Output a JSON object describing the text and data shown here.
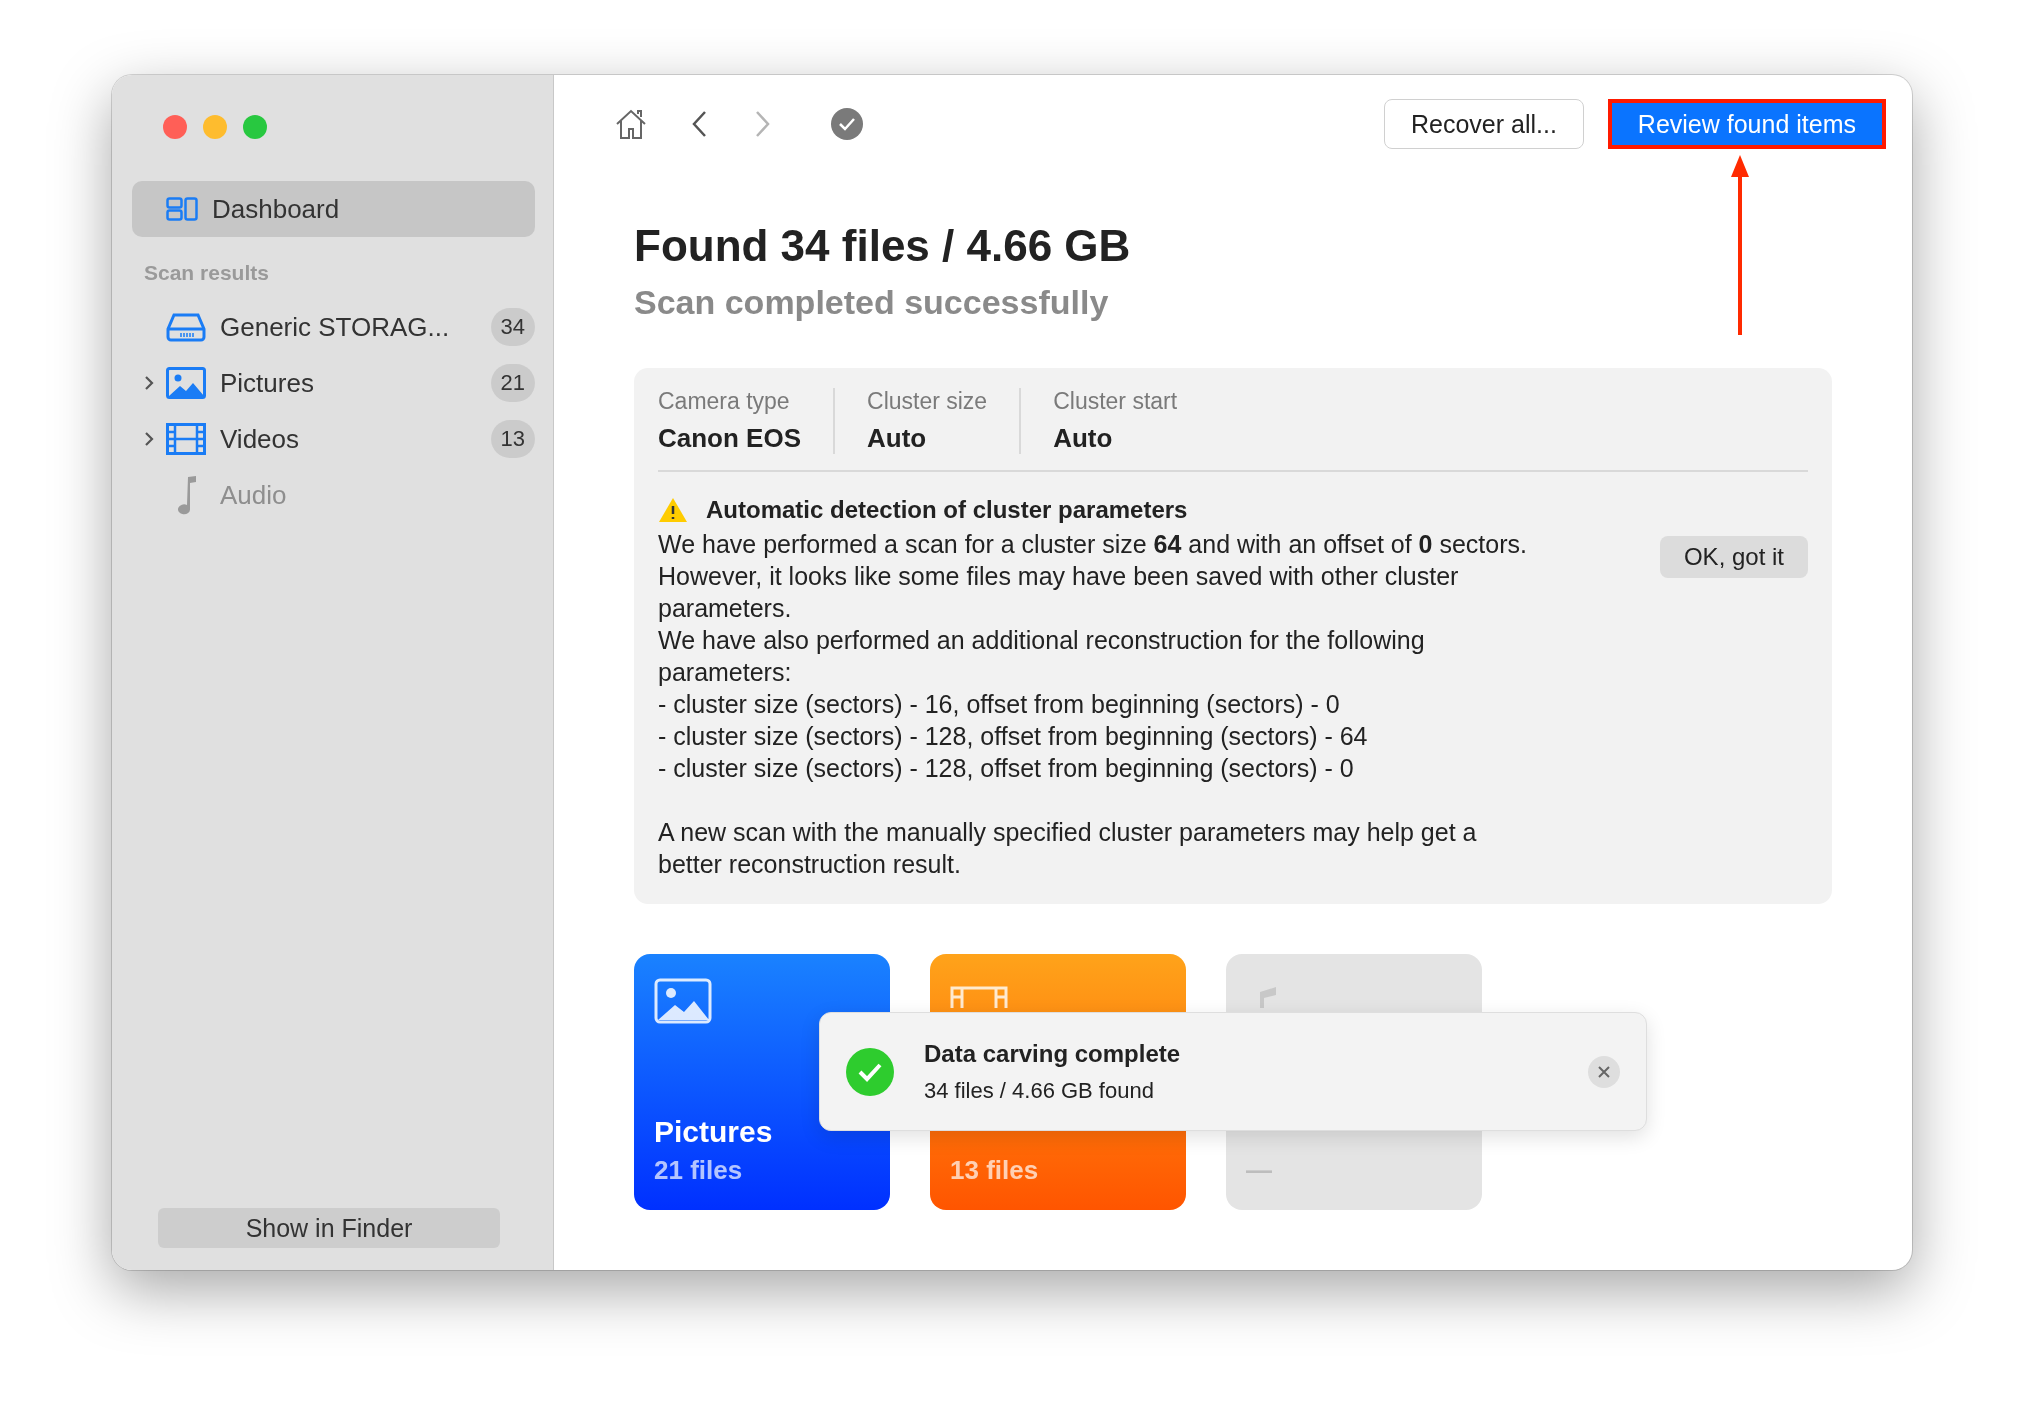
{
  "sidebar": {
    "items": [
      {
        "label": "Dashboard",
        "selected": true
      }
    ],
    "section_label": "Scan results",
    "results": [
      {
        "kind": "drive",
        "label": "Generic STORAG...",
        "count": "34",
        "disabled": false
      },
      {
        "kind": "pictures",
        "label": "Pictures",
        "count": "21",
        "expanded": false,
        "disabled": false
      },
      {
        "kind": "videos",
        "label": "Videos",
        "count": "13",
        "expanded": false,
        "disabled": false
      },
      {
        "kind": "audio",
        "label": "Audio",
        "disabled": true
      }
    ],
    "footer_button": "Show in Finder"
  },
  "toolbar": {
    "forward_disabled": true,
    "buttons": [
      {
        "label": "Recover all...",
        "primary": false
      },
      {
        "label": "Review found items",
        "primary": true,
        "highlighted": true
      }
    ]
  },
  "title": "Found 34 files / 4.66 GB",
  "subtitle": "Scan completed successfully",
  "info": {
    "params": [
      {
        "label": "Camera type",
        "value": "Canon EOS"
      },
      {
        "label": "Cluster size",
        "value": "Auto"
      },
      {
        "label": "Cluster start",
        "value": "Auto"
      }
    ],
    "warning_title": "Automatic detection of cluster parameters",
    "paragraphs": [
      "We have performed a scan for a cluster size **64** and with an offset of **0** sectors. However, it looks like some files may have been saved with other cluster parameters.",
      "We have also performed an additional reconstruction for the following parameters:",
      "- cluster size (sectors) - 16, offset from beginning (sectors) - 0",
      "- cluster size (sectors) - 128, offset from beginning (sectors) - 64",
      "- cluster size (sectors) - 128, offset from beginning (sectors) - 0",
      "A new scan with the manually specified cluster parameters may help get a better reconstruction result."
    ],
    "button": "OK, got it"
  },
  "cards": [
    {
      "kind": "pictures",
      "title": "Pictures",
      "count": "21 files",
      "disabled": false
    },
    {
      "kind": "videos",
      "count": "13 files",
      "disabled": false
    },
    {
      "kind": "audio",
      "count": "—",
      "disabled": true
    }
  ],
  "toast": {
    "title": "Data carving complete",
    "message": "34 files / 4.66 GB found"
  }
}
